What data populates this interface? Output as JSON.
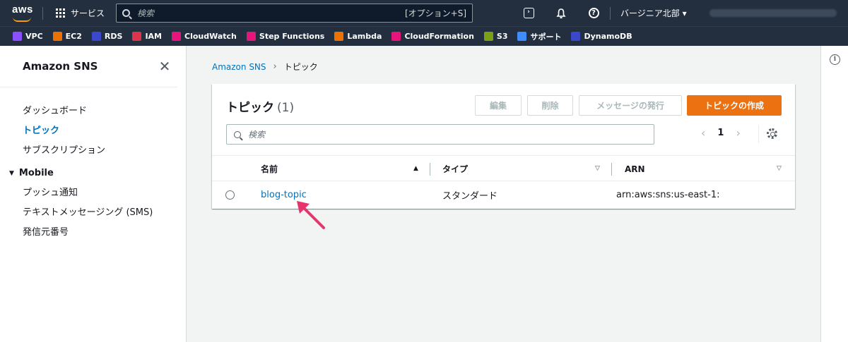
{
  "topnav": {
    "logo": "aws",
    "services_label": "サービス",
    "search_placeholder": "検索",
    "search_shortcut": "[オプション+S]",
    "region": "バージニア北部 ▾"
  },
  "favorites": [
    {
      "label": "VPC",
      "color": "#8c4fff"
    },
    {
      "label": "EC2",
      "color": "#ed7100"
    },
    {
      "label": "RDS",
      "color": "#3b48cc"
    },
    {
      "label": "IAM",
      "color": "#dd344c"
    },
    {
      "label": "CloudWatch",
      "color": "#e7157b"
    },
    {
      "label": "Step Functions",
      "color": "#e7157b"
    },
    {
      "label": "Lambda",
      "color": "#ed7100"
    },
    {
      "label": "CloudFormation",
      "color": "#e7157b"
    },
    {
      "label": "S3",
      "color": "#7aa116"
    },
    {
      "label": "サポート",
      "color": "#3f8cff"
    },
    {
      "label": "DynamoDB",
      "color": "#3b48cc"
    }
  ],
  "sidenav": {
    "title": "Amazon SNS",
    "items": [
      "ダッシュボード",
      "トピック",
      "サブスクリプション"
    ],
    "active_item": "トピック",
    "section": {
      "label": "Mobile",
      "items": [
        "プッシュ通知",
        "テキストメッセージング (SMS)",
        "発信元番号"
      ]
    }
  },
  "breadcrumb": {
    "root": "Amazon SNS",
    "current": "トピック"
  },
  "topics": {
    "title": "トピック",
    "count": "(1)",
    "buttons": {
      "edit": "編集",
      "delete": "削除",
      "publish": "メッセージの発行",
      "create": "トピックの作成"
    },
    "filter_placeholder": "検索",
    "page": "1",
    "columns": [
      "名前",
      "タイプ",
      "ARN"
    ],
    "rows": [
      {
        "name": "blog-topic",
        "type": "スタンダード",
        "arn": "arn:aws:sns:us-east-1:"
      }
    ]
  },
  "colors": {
    "nav_bg": "#232f3e",
    "accent": "#ec7211",
    "link": "#0073bb",
    "annotation_arrow": "#e8336b"
  }
}
